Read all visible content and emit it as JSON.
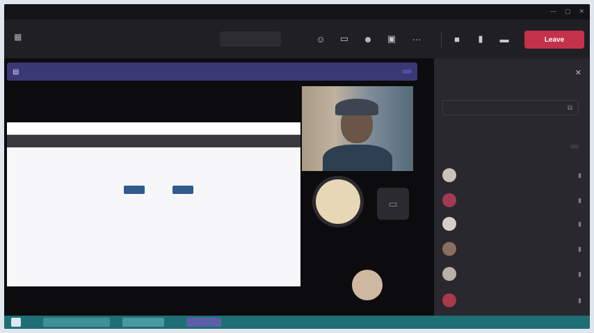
{
  "window": {
    "title": "",
    "controls": [
      "—",
      "▢",
      "✕"
    ]
  },
  "toolbar": {
    "timer": "",
    "pill_label": "",
    "leave_label": "Leave"
  },
  "banner": {
    "presenter": "",
    "message": "",
    "stop_label": ""
  },
  "shared_doc": {
    "bar_label": "",
    "heading": "",
    "chips": [
      "",
      "",
      "",
      ""
    ]
  },
  "stage_label": "",
  "tiles": {
    "main_initials": "",
    "main_name": "",
    "small_initials": ""
  },
  "people_panel": {
    "title": "",
    "invite_placeholder": "",
    "share_link": "",
    "section_label": "",
    "section_action": "",
    "participants": [
      {
        "name": "",
        "color": "#c9c2b8"
      },
      {
        "name": "",
        "color": "#a23b52"
      },
      {
        "name": "",
        "color": "#d4cfc9"
      },
      {
        "name": "",
        "color": "#8c6d62"
      },
      {
        "name": "",
        "color": "#b9b1a8"
      },
      {
        "name": "",
        "color": "#a83a4a"
      }
    ]
  },
  "taskbar": {
    "clock": ""
  },
  "colors": {
    "accent": "#3a3875",
    "leave": "#c4314b",
    "taskbar": "#1e6e74"
  }
}
